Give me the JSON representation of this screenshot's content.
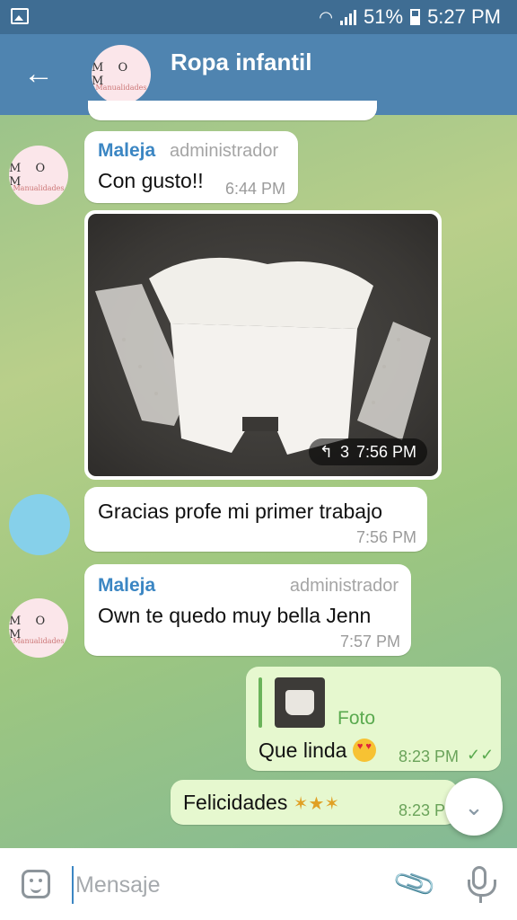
{
  "status_bar": {
    "battery_percent": "51%",
    "time": "5:27 PM"
  },
  "header": {
    "title": "Ropa infantil",
    "logo_text": "M O M",
    "logo_script": "Manualidades"
  },
  "messages": [
    {
      "sender": "Maleja",
      "role": "administrador",
      "text": "Con gusto!!",
      "time": "6:44 PM"
    },
    {
      "type": "photo",
      "reply_count": "3",
      "time": "7:56 PM"
    },
    {
      "text": "Gracias profe mi primer trabajo",
      "time": "7:56 PM"
    },
    {
      "sender": "Maleja",
      "role": "administrador",
      "text": "Own te quedo muy bella Jenn",
      "time": "7:57 PM"
    },
    {
      "reply_label": "Foto",
      "text": "Que linda",
      "time": "8:23 PM"
    },
    {
      "text": "Felicidades",
      "time": "8:23 PM"
    }
  ],
  "input": {
    "placeholder": "Mensaje"
  },
  "colors": {
    "status_bar": "#3f6d93",
    "app_bar": "#4f84b0",
    "sender_name": "#3b86c3",
    "outgoing_bubble": "#e6f8cf",
    "check_green": "#5aaa4f"
  }
}
